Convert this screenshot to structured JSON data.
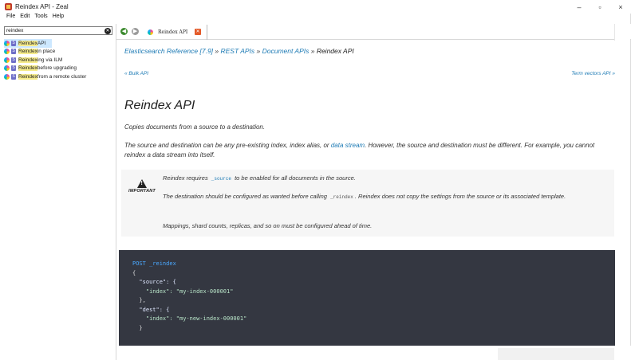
{
  "window": {
    "title": "Reindex API - Zeal",
    "controls": {
      "minimize": "–",
      "maximize": "▫",
      "close": "×"
    }
  },
  "menu": [
    "File",
    "Edit",
    "Tools",
    "Help"
  ],
  "search": {
    "value": "reindex",
    "clear": "✕"
  },
  "results": [
    {
      "hl": "Reindex",
      "rest": " API"
    },
    {
      "hl": "Reindex",
      "rest": " in place"
    },
    {
      "hl": "Reindex",
      "rest": "ing via ILM"
    },
    {
      "hl": "Reindex",
      "rest": " before upgrading"
    },
    {
      "hl": "Reindex",
      "rest": " from a remote cluster"
    }
  ],
  "tab": {
    "label": "Reindex API",
    "close": "✕"
  },
  "nav": {
    "back": "◀",
    "forward": "▶"
  },
  "breadcrumb": {
    "items": [
      "Elasticsearch Reference [7.9]",
      "REST APIs",
      "Document APIs"
    ],
    "sep": " » ",
    "current": "Reindex API"
  },
  "prev_link": "« Bulk API",
  "next_link": "Term vectors API »",
  "title": "Reindex API",
  "intro": "Copies documents from a source to a destination.",
  "para2": {
    "before": "The source and destination can be any pre-existing index, index alias, or ",
    "link": "data stream",
    "after": ". However, the source and destination must be different. For example, you cannot reindex a data stream into itself."
  },
  "admonition": {
    "label": "IMPORTANT",
    "line1_before": "Reindex requires ",
    "line1_code": "_source",
    "line1_after": " to be enabled for all documents in the source.",
    "line2_before": "The destination should be configured as wanted before calling ",
    "line2_code": "_reindex",
    "line2_after": ". Reindex does not copy the settings from the source or its associated template.",
    "line3": "Mappings, shard counts, replicas, and so on must be configured ahead of time."
  },
  "code": {
    "method": "POST",
    "path": "_reindex",
    "lines": [
      "{",
      "  \"source\": {",
      "    \"index\": \"my-index-000001\"",
      "  },",
      "  \"dest\": {",
      "    \"index\": \"my-new-index-000001\"",
      "  }"
    ]
  }
}
